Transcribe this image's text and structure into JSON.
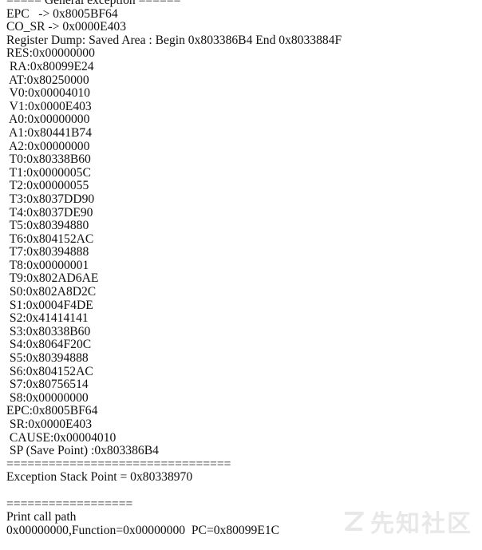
{
  "console": {
    "lines": [
      "===== General exception ======",
      "EPC   -> 0x8005BF64",
      "CO_SR -> 0x0000E403",
      "Register Dump: Saved Area : Begin 0x803386B4 End 0x8033884F",
      "RES:0x00000000",
      " RA:0x80099E24",
      " AT:0x80250000",
      " V0:0x00004010",
      " V1:0x0000E403",
      " A0:0x00000000",
      " A1:0x80441B74",
      " A2:0x00000000",
      " T0:0x80338B60",
      " T1:0x0000005C",
      " T2:0x00000055",
      " T3:0x8037DD90",
      " T4:0x8037DE90",
      " T5:0x80394880",
      " T6:0x804152AC",
      " T7:0x80394888",
      " T8:0x00000001",
      " T9:0x802AD6AE",
      " S0:0x802A8D2C",
      " S1:0x0004F4DE",
      " S2:0x41414141",
      " S3:0x80338B60",
      " S4:0x8064F20C",
      " S5:0x80394888",
      " S6:0x804152AC",
      " S7:0x80756514",
      " S8:0x00000000",
      "EPC:0x8005BF64",
      " SR:0x0000E403",
      " CAUSE:0x00004010",
      " SP (Save Point) :0x803386B4",
      "================================",
      "Exception Stack Point = 0x80338970",
      "",
      "==================",
      "Print call path",
      "0x00000000,Function=0x00000000  PC=0x80099E1C"
    ]
  },
  "watermark": {
    "text": "先知社区",
    "icon": "xianzhi-logo-icon"
  }
}
